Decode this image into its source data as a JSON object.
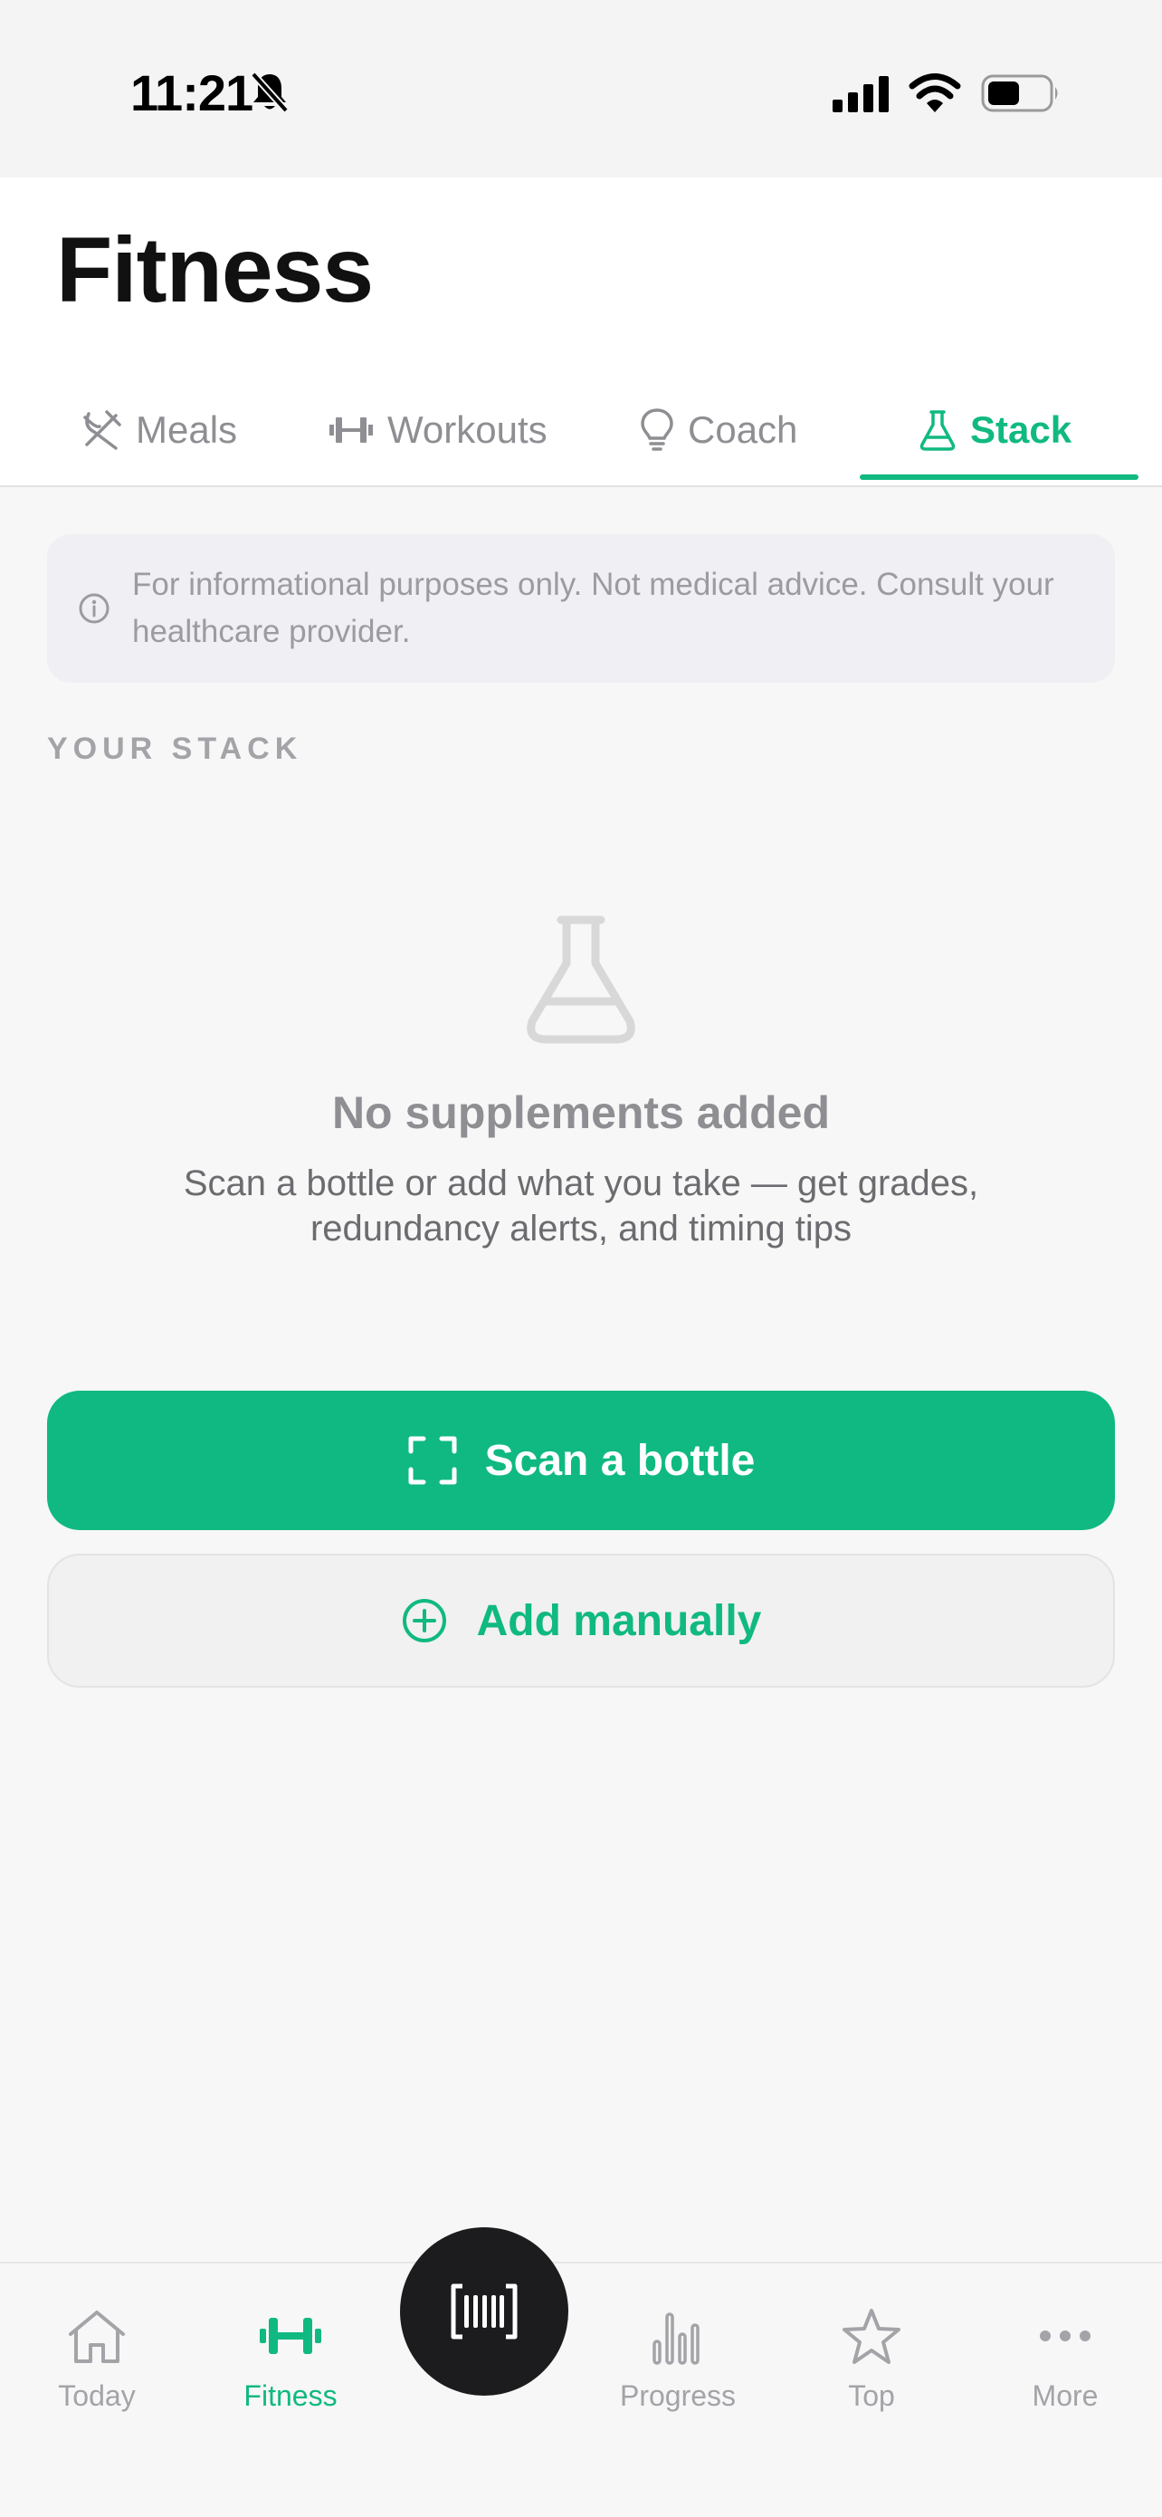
{
  "status_bar": {
    "time": "11:21"
  },
  "header": {
    "title": "Fitness"
  },
  "tabs": [
    {
      "label": "Meals",
      "icon": "fork-knife-icon"
    },
    {
      "label": "Workouts",
      "icon": "dumbbell-icon"
    },
    {
      "label": "Coach",
      "icon": "lightbulb-icon"
    },
    {
      "label": "Stack",
      "icon": "flask-icon",
      "active": true
    }
  ],
  "disclaimer": {
    "text": "For informational purposes only. Not medical advice. Consult your healthcare provider."
  },
  "section": {
    "label": "YOUR STACK"
  },
  "empty_state": {
    "title": "No supplements added",
    "description": "Scan a bottle or add what you take — get grades, redundancy alerts, and timing tips"
  },
  "actions": {
    "scan_label": "Scan a bottle",
    "add_label": "Add manually"
  },
  "bottom_nav": {
    "items": [
      {
        "label": "Today"
      },
      {
        "label": "Fitness",
        "active": true
      },
      {
        "label": "Progress"
      },
      {
        "label": "Top"
      },
      {
        "label": "More"
      }
    ]
  },
  "colors": {
    "accent": "#10b981",
    "dark": "#1c1c1e",
    "muted": "#8e8e93"
  }
}
